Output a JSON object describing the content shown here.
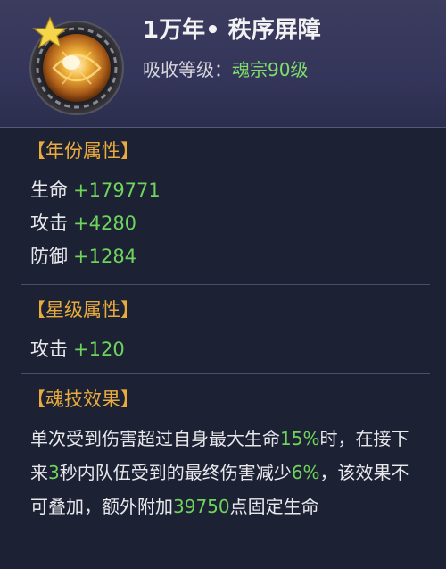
{
  "header": {
    "title": "1万年• 秩序屏障",
    "absorb_label": "吸收等级：",
    "absorb_value": "魂宗90级",
    "icon": "soul-ring-orb-icon"
  },
  "year_attributes": {
    "title": "【年份属性】",
    "stats": [
      {
        "name": "生命",
        "value": "+179771"
      },
      {
        "name": "攻击",
        "value": "+4280"
      },
      {
        "name": "防御",
        "value": "+1284"
      }
    ]
  },
  "star_attributes": {
    "title": "【星级属性】",
    "stats": [
      {
        "name": "攻击",
        "value": "+120"
      }
    ]
  },
  "skill_effect": {
    "title": "【魂技效果】",
    "segments": [
      {
        "text": "单次受到伤害超过自身最大生命",
        "hl": false
      },
      {
        "text": "15%",
        "hl": true
      },
      {
        "text": "时，在接下来",
        "hl": false
      },
      {
        "text": "3",
        "hl": true
      },
      {
        "text": "秒内队伍受到的最终伤害减少",
        "hl": false
      },
      {
        "text": "6%",
        "hl": true
      },
      {
        "text": "，该效果不可叠加，额外附加",
        "hl": false
      },
      {
        "text": "39750",
        "hl": true
      },
      {
        "text": "点固定生命",
        "hl": false
      }
    ]
  },
  "colors": {
    "accent_title": "#e9ac3c",
    "highlight_green": "#6fd45c",
    "panel_bg": "#1c2134",
    "header_bg": "#34355a"
  }
}
